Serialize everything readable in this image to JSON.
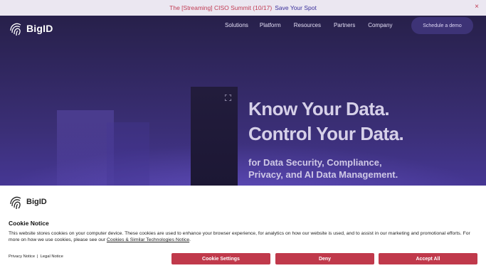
{
  "announcement": {
    "text": "The [Streaming] CISO Summit (10/17)",
    "cta": "Save Your Spot",
    "close": "×"
  },
  "brand": {
    "name": "BigID"
  },
  "nav": {
    "items": [
      "Solutions",
      "Platform",
      "Resources",
      "Partners",
      "Company"
    ],
    "demo_button": "Schedule a demo"
  },
  "hero": {
    "headline_line1": "Know Your Data.",
    "headline_line2": "Control Your Data.",
    "sub_line1": "for Data Security, Compliance,",
    "sub_line2": "Privacy, and AI Data Management."
  },
  "cookie": {
    "title": "Cookie Notice",
    "body": "This website stores cookies on your computer device. These cookies are used to enhance your browser experience, for analytics on how our website is used, and to assist in our marketing and promotional efforts. For more on how we use cookies, please see our ",
    "body_link": "Cookies & Similar Technologies Notice",
    "body_end": ".",
    "privacy_link": "Privacy Notice",
    "legal_link": "Legal Notice",
    "buttons": {
      "settings": "Cookie Settings",
      "deny": "Deny",
      "accept": "Accept All"
    }
  },
  "colors": {
    "accent_red": "#c0394b",
    "announce_text": "#c03a52",
    "hero_bg": "#3b2f77"
  }
}
